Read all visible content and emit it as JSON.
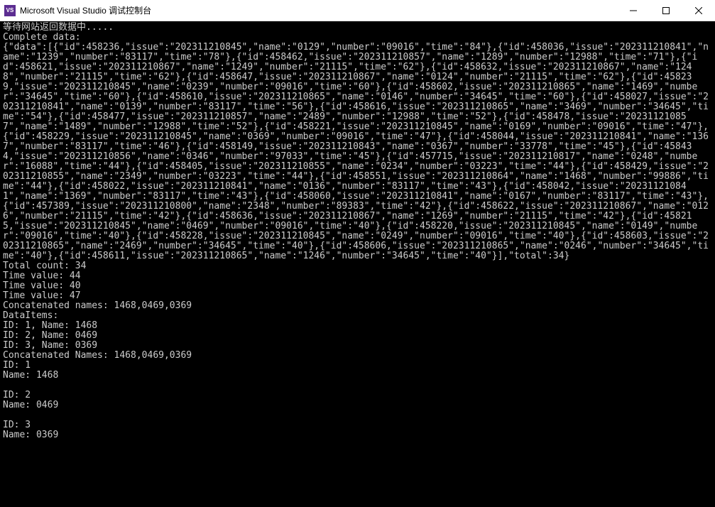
{
  "window": {
    "title": "Microsoft Visual Studio 调试控制台",
    "icon_label": "VS"
  },
  "console": {
    "lines": {
      "wait": "等待网站返回数据中.....",
      "complete": "Complete data:",
      "json_dump": "{\"data\":[{\"id\":458236,\"issue\":\"202311210845\",\"name\":\"0129\",\"number\":\"09016\",\"time\":\"84\"},{\"id\":458036,\"issue\":\"202311210841\",\"name\":\"1239\",\"number\":\"83117\",\"time\":\"78\"},{\"id\":458462,\"issue\":\"202311210857\",\"name\":\"1289\",\"number\":\"12988\",\"time\":\"71\"},{\"id\":458621,\"issue\":\"202311210867\",\"name\":\"1249\",\"number\":\"21115\",\"time\":\"62\"},{\"id\":458632,\"issue\":\"202311210867\",\"name\":\"1248\",\"number\":\"21115\",\"time\":\"62\"},{\"id\":458647,\"issue\":\"202311210867\",\"name\":\"0124\",\"number\":\"21115\",\"time\":\"62\"},{\"id\":458239,\"issue\":\"202311210845\",\"name\":\"0239\",\"number\":\"09016\",\"time\":\"60\"},{\"id\":458602,\"issue\":\"202311210865\",\"name\":\"1469\",\"number\":\"34645\",\"time\":\"60\"},{\"id\":458610,\"issue\":\"202311210865\",\"name\":\"0146\",\"number\":\"34645\",\"time\":\"60\"},{\"id\":458027,\"issue\":\"202311210841\",\"name\":\"0139\",\"number\":\"83117\",\"time\":\"56\"},{\"id\":458616,\"issue\":\"202311210865\",\"name\":\"3469\",\"number\":\"34645\",\"time\":\"54\"},{\"id\":458477,\"issue\":\"202311210857\",\"name\":\"2489\",\"number\":\"12988\",\"time\":\"52\"},{\"id\":458478,\"issue\":\"202311210857\",\"name\":\"1489\",\"number\":\"12988\",\"time\":\"52\"},{\"id\":458221,\"issue\":\"202311210845\",\"name\":\"0169\",\"number\":\"09016\",\"time\":\"47\"},{\"id\":458229,\"issue\":\"202311210845\",\"name\":\"0369\",\"number\":\"09016\",\"time\":\"47\"},{\"id\":458044,\"issue\":\"202311210841\",\"name\":\"1367\",\"number\":\"83117\",\"time\":\"46\"},{\"id\":458149,\"issue\":\"202311210843\",\"name\":\"0367\",\"number\":\"33778\",\"time\":\"45\"},{\"id\":458434,\"issue\":\"202311210856\",\"name\":\"0346\",\"number\":\"97033\",\"time\":\"45\"},{\"id\":457715,\"issue\":\"202311210817\",\"name\":\"0248\",\"number\":\"16088\",\"time\":\"44\"},{\"id\":458405,\"issue\":\"202311210855\",\"name\":\"0234\",\"number\":\"03223\",\"time\":\"44\"},{\"id\":458429,\"issue\":\"202311210855\",\"name\":\"2349\",\"number\":\"03223\",\"time\":\"44\"},{\"id\":458551,\"issue\":\"202311210864\",\"name\":\"1468\",\"number\":\"99886\",\"time\":\"44\"},{\"id\":458022,\"issue\":\"202311210841\",\"name\":\"0136\",\"number\":\"83117\",\"time\":\"43\"},{\"id\":458042,\"issue\":\"202311210841\",\"name\":\"1369\",\"number\":\"83117\",\"time\":\"43\"},{\"id\":458060,\"issue\":\"202311210841\",\"name\":\"0167\",\"number\":\"83117\",\"time\":\"43\"},{\"id\":457389,\"issue\":\"202311210800\",\"name\":\"2348\",\"number\":\"89383\",\"time\":\"42\"},{\"id\":458622,\"issue\":\"202311210867\",\"name\":\"0126\",\"number\":\"21115\",\"time\":\"42\"},{\"id\":458636,\"issue\":\"202311210867\",\"name\":\"1269\",\"number\":\"21115\",\"time\":\"42\"},{\"id\":458215,\"issue\":\"202311210845\",\"name\":\"0469\",\"number\":\"09016\",\"time\":\"40\"},{\"id\":458220,\"issue\":\"202311210845\",\"name\":\"0149\",\"number\":\"09016\",\"time\":\"40\"},{\"id\":458228,\"issue\":\"202311210845\",\"name\":\"0249\",\"number\":\"09016\",\"time\":\"40\"},{\"id\":458603,\"issue\":\"202311210865\",\"name\":\"2469\",\"number\":\"34645\",\"time\":\"40\"},{\"id\":458606,\"issue\":\"202311210865\",\"name\":\"0246\",\"number\":\"34645\",\"time\":\"40\"},{\"id\":458611,\"issue\":\"202311210865\",\"name\":\"1246\",\"number\":\"34645\",\"time\":\"40\"}],\"total\":34}",
      "total": "Total count: 34",
      "t1": "Time value: 44",
      "t2": "Time value: 40",
      "t3": "Time value: 47",
      "concat1": "Concatenated names: 1468,0469,0369",
      "dataitems": "DataItems:",
      "di1": "ID: 1, Name: 1468",
      "di2": "ID: 2, Name: 0469",
      "di3": "ID: 3, Name: 0369",
      "concat2": "Concatenated Names: 1468,0469,0369",
      "id1": "ID: 1",
      "name1": "Name: 1468",
      "blank1": "",
      "id2": "ID: 2",
      "name2": "Name: 0469",
      "blank2": "",
      "id3": "ID: 3",
      "name3": "Name: 0369"
    }
  }
}
